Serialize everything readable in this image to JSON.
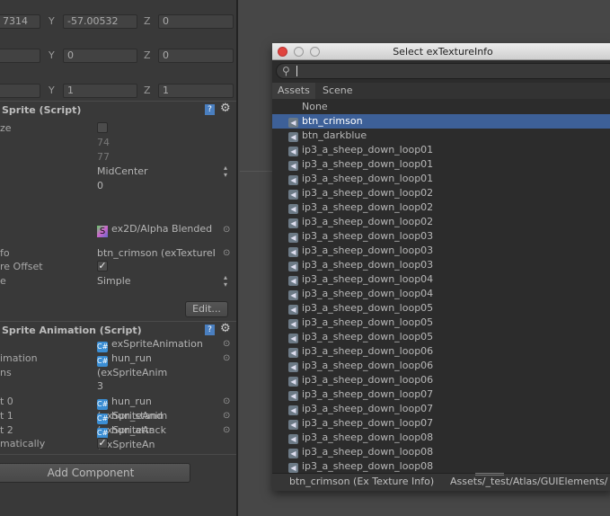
{
  "inspector": {
    "transform": [
      {
        "x": "7314",
        "y": "-57.00532",
        "z": "0"
      },
      {
        "x": "",
        "y": "0",
        "z": "0"
      },
      {
        "x": "",
        "y": "1",
        "z": "1"
      }
    ],
    "axis": {
      "y": "Y",
      "z": "Z"
    },
    "sprite": {
      "header": "Sprite (Script)",
      "rows": {
        "size_label": "ze",
        "width": "74",
        "height": "77",
        "anchor": "MidCenter",
        "anchor_extra": "0",
        "material": "ex2D/Alpha Blended",
        "info_label": "fo",
        "info": "btn_crimson (exTextureI",
        "offset_label": "re Offset",
        "type_label": "e",
        "type": "Simple"
      },
      "edit": "Edit..."
    },
    "anim": {
      "header": "Sprite Animation (Script)",
      "script": "exSpriteAnimation",
      "default_label": "imation",
      "default": "hun_run (exSpriteAnim",
      "anims_label": "ns",
      "size": "3",
      "elements": [
        {
          "label": "t 0",
          "value": "hun_run (exSpriteAnim"
        },
        {
          "label": "t 1",
          "value": "hun_stand (exSpriteAn"
        },
        {
          "label": "t 2",
          "value": "hun_attack (exSpriteAn"
        }
      ],
      "auto_label": "matically"
    },
    "add_component": "Add Component"
  },
  "window": {
    "title": "Select exTextureInfo",
    "search": "",
    "tabs": [
      "Assets",
      "Scene"
    ],
    "items": [
      "None",
      "btn_crimson",
      "btn_darkblue",
      "ip3_a_sheep_down_loop01",
      "ip3_a_sheep_down_loop01",
      "ip3_a_sheep_down_loop01",
      "ip3_a_sheep_down_loop02",
      "ip3_a_sheep_down_loop02",
      "ip3_a_sheep_down_loop02",
      "ip3_a_sheep_down_loop03",
      "ip3_a_sheep_down_loop03",
      "ip3_a_sheep_down_loop03",
      "ip3_a_sheep_down_loop04",
      "ip3_a_sheep_down_loop04",
      "ip3_a_sheep_down_loop05",
      "ip3_a_sheep_down_loop05",
      "ip3_a_sheep_down_loop05",
      "ip3_a_sheep_down_loop06",
      "ip3_a_sheep_down_loop06",
      "ip3_a_sheep_down_loop06",
      "ip3_a_sheep_down_loop07",
      "ip3_a_sheep_down_loop07",
      "ip3_a_sheep_down_loop07",
      "ip3_a_sheep_down_loop08",
      "ip3_a_sheep_down_loop08",
      "ip3_a_sheep_down_loop08"
    ],
    "selected": "btn_crimson",
    "footer": {
      "name": "btn_crimson (Ex Texture Info)",
      "path": "Assets/_test/Atlas/GUIElements/"
    }
  },
  "colors": {
    "selection": "#3d6098"
  }
}
